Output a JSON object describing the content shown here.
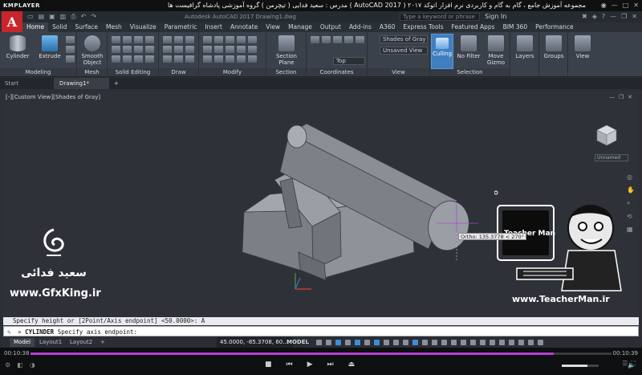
{
  "player": {
    "logo": "KMPLAYER",
    "caption": "مجموعه آموزش جامع ، گام به گام و کاربردی نرم افزار اتوکد ۲۰۱۷ ( AutoCAD 2017 ) مدرس : سعید فدایی ( تیچرمن ) گروه آموزشی پادشاه گرافیست ها",
    "time_elapsed": "00:10:38",
    "time_total": "00:10:39",
    "progress": 0.9,
    "volume": 0.7
  },
  "titlebar": {
    "center": "Autodesk AutoCAD 2017   Drawing1.dwg",
    "search_placeholder": "Type a keyword or phrase",
    "sign_in": "Sign In"
  },
  "ribbon_tabs": [
    "Home",
    "Solid",
    "Surface",
    "Mesh",
    "Visualize",
    "Parametric",
    "Insert",
    "Annotate",
    "View",
    "Manage",
    "Output",
    "Add-ins",
    "A360",
    "Express Tools",
    "Featured Apps",
    "BIM 360",
    "Performance"
  ],
  "ribbon": {
    "cylinder": "Cylinder",
    "extrude": "Extrude",
    "smooth_object": "Smooth Object",
    "section_plane": "Section Plane",
    "shades_of_gray": "Shades of Gray",
    "unsaved_view": "Unsaved View",
    "top": "Top",
    "culling": "Culling",
    "no_filter": "No Filter",
    "move_gizmo": "Move Gizmo",
    "layers": "Layers",
    "groups": "Groups",
    "view_btn": "View",
    "groups_labels": {
      "modeling": "Modeling",
      "mesh": "Mesh",
      "solid_editing": "Solid Editing",
      "draw": "Draw",
      "modify": "Modify",
      "section": "Section",
      "coordinates": "Coordinates",
      "view": "View",
      "selection": "Selection"
    }
  },
  "file_tabs": [
    "Start",
    "Drawing1*"
  ],
  "viewport": {
    "label": "[-][Custom View][Shades of Gray]",
    "unnamed": "Unnamed",
    "tooltip": "Ortho: 135.3778 < 270°"
  },
  "watermark": {
    "left_name": "سعید فدائی",
    "left_site": "www.GfxKing.ir",
    "right_site": "www.TeacherMan.ir",
    "right_brand": "Teacher Man"
  },
  "command": {
    "history": "Specify height or [2Point/Axis endpoint] <50.0000>: A",
    "prompt_name": "CYLINDER",
    "prompt_text": "Specify axis endpoint:"
  },
  "status": {
    "tabs": [
      "Model",
      "Layout1",
      "Layout2"
    ],
    "coords": "45.0000, -85.3708, 60....",
    "model": "MODEL"
  }
}
